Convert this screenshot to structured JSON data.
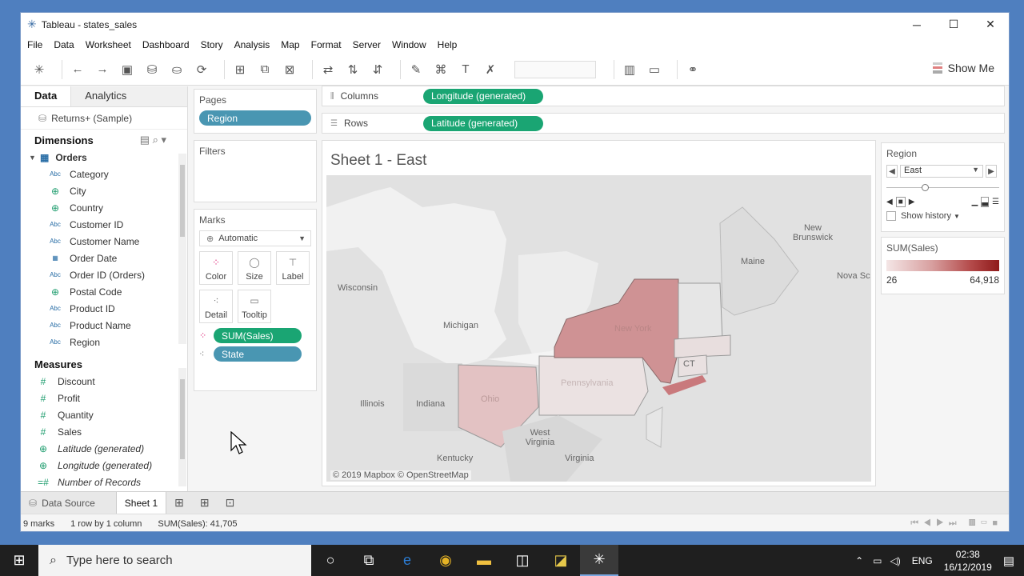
{
  "window": {
    "title": "Tableau - states_sales"
  },
  "menu": [
    "File",
    "Data",
    "Worksheet",
    "Dashboard",
    "Story",
    "Analysis",
    "Map",
    "Format",
    "Server",
    "Window",
    "Help"
  ],
  "toolbar": {
    "show_me": "Show Me"
  },
  "data_pane": {
    "tab_data": "Data",
    "tab_analytics": "Analytics",
    "datasource": "Returns+ (Sample)",
    "dimensions_header": "Dimensions",
    "table": "Orders",
    "dimensions": [
      {
        "type": "Abc",
        "name": "Category"
      },
      {
        "type": "geo",
        "name": "City"
      },
      {
        "type": "geo",
        "name": "Country"
      },
      {
        "type": "Abc",
        "name": "Customer ID"
      },
      {
        "type": "Abc",
        "name": "Customer Name"
      },
      {
        "type": "date",
        "name": "Order Date"
      },
      {
        "type": "Abc",
        "name": "Order ID (Orders)"
      },
      {
        "type": "geo",
        "name": "Postal Code"
      },
      {
        "type": "Abc",
        "name": "Product ID"
      },
      {
        "type": "Abc",
        "name": "Product Name"
      },
      {
        "type": "Abc",
        "name": "Region"
      }
    ],
    "measures_header": "Measures",
    "measures": [
      {
        "type": "#",
        "name": "Discount"
      },
      {
        "type": "#",
        "name": "Profit"
      },
      {
        "type": "#",
        "name": "Quantity"
      },
      {
        "type": "#",
        "name": "Sales"
      },
      {
        "type": "geo",
        "name": "Latitude (generated)"
      },
      {
        "type": "geo",
        "name": "Longitude (generated)"
      },
      {
        "type": "=#",
        "name": "Number of Records"
      }
    ]
  },
  "pages": {
    "label": "Pages",
    "pill": "Region"
  },
  "filters": {
    "label": "Filters"
  },
  "marks": {
    "label": "Marks",
    "type": "Automatic",
    "buttons": [
      "Color",
      "Size",
      "Label",
      "Detail",
      "Tooltip"
    ],
    "pills": [
      "SUM(Sales)",
      "State"
    ]
  },
  "columns": {
    "label": "Columns",
    "pill": "Longitude (generated)"
  },
  "rows": {
    "label": "Rows",
    "pill": "Latitude (generated)"
  },
  "view": {
    "title": "Sheet 1 - East",
    "attribution": "© 2019 Mapbox © OpenStreetMap",
    "labels": [
      "Wisconsin",
      "Michigan",
      "Illinois",
      "Indiana",
      "Ohio",
      "Kentucky",
      "West Virginia",
      "Virginia",
      "Pennsylvania",
      "New York",
      "CT",
      "Maine",
      "New Brunswick",
      "Nova Sc"
    ]
  },
  "region_filter": {
    "label": "Region",
    "value": "East",
    "show_history": "Show history"
  },
  "color_legend": {
    "label": "SUM(Sales)",
    "min": "26",
    "max": "64,918",
    "colors": [
      "#f4e6e6",
      "#8f1a1a"
    ]
  },
  "sheet_tabs": {
    "data_source": "Data Source",
    "sheet": "Sheet 1"
  },
  "status": {
    "marks": "9 marks",
    "dims": "1 row by 1 column",
    "sum": "SUM(Sales): 41,705"
  },
  "taskbar": {
    "search_placeholder": "Type here to search",
    "lang": "ENG",
    "time": "02:38",
    "date": "16/12/2019"
  }
}
